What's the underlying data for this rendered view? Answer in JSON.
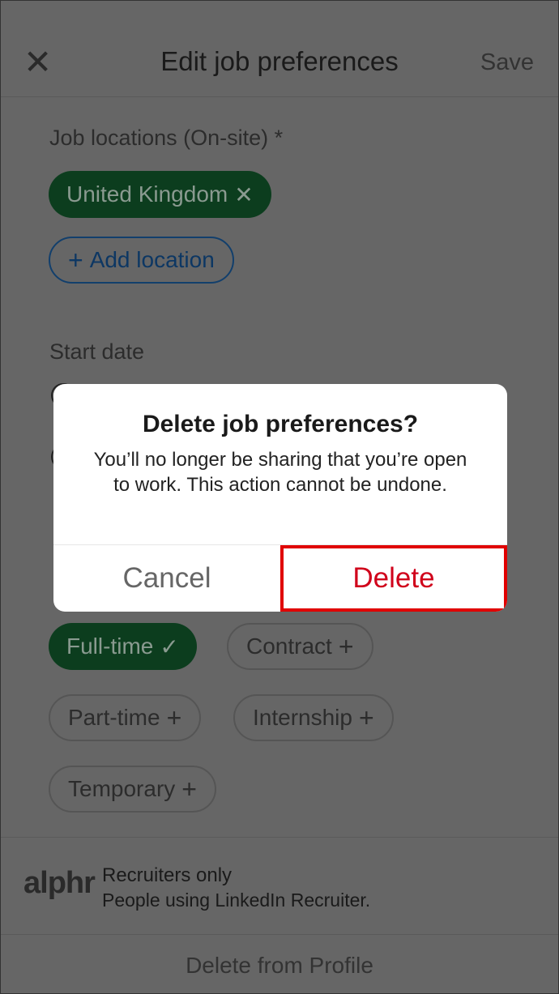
{
  "header": {
    "title": "Edit job preferences",
    "save_label": "Save",
    "close_icon": "close-icon"
  },
  "locations": {
    "label": "Job locations (On-site) *",
    "chips": [
      {
        "label": "United Kingdom",
        "icon": "✕"
      }
    ],
    "add_label": "Add location"
  },
  "start_date": {
    "label": "Start date"
  },
  "job_types": {
    "chips": [
      {
        "label": "Full-time",
        "icon": "✓",
        "selected": true
      },
      {
        "label": "Contract",
        "icon": "+",
        "selected": false
      },
      {
        "label": "Part-time",
        "icon": "+",
        "selected": false
      },
      {
        "label": "Internship",
        "icon": "+",
        "selected": false
      },
      {
        "label": "Temporary",
        "icon": "+",
        "selected": false
      }
    ]
  },
  "visibility": {
    "logo": "alphr",
    "title": "Recruiters only",
    "subtitle": "People using LinkedIn Recruiter."
  },
  "footer": {
    "delete_label": "Delete from Profile"
  },
  "dialog": {
    "title": "Delete job preferences?",
    "message": "You’ll no longer be sharing that you’re open to work. This action cannot be undone.",
    "cancel_label": "Cancel",
    "delete_label": "Delete",
    "delete_color": "#d0021b",
    "highlight_color": "#e00000"
  }
}
